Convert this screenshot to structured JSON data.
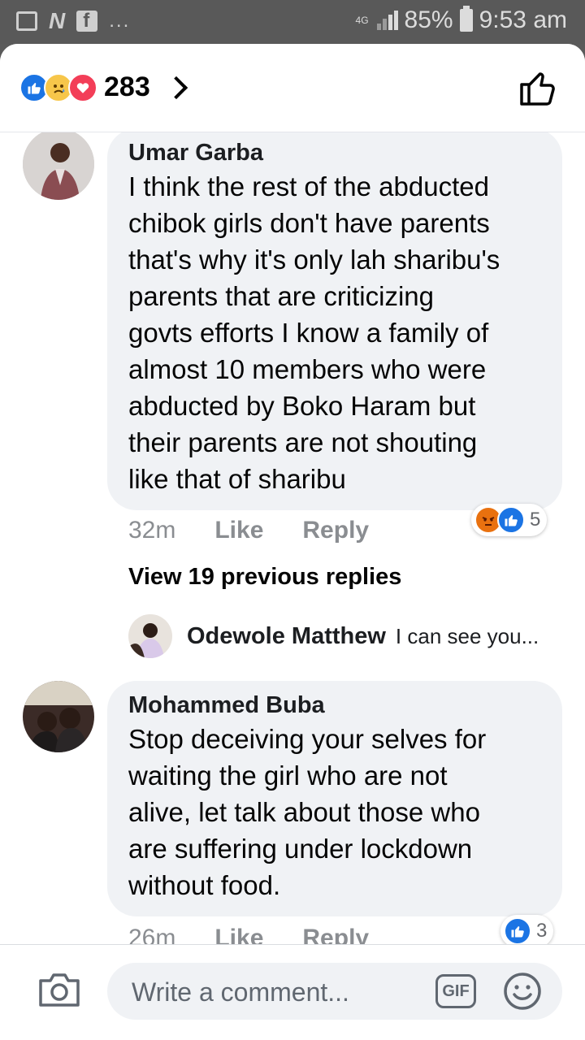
{
  "status_bar": {
    "network": "4G",
    "battery": "85%",
    "time": "9:53 am"
  },
  "header": {
    "reaction_count": "283",
    "reaction_icons": [
      "like-icon",
      "sad-icon",
      "love-icon"
    ]
  },
  "comments": [
    {
      "author": "Umar Garba",
      "text": "I think the rest of the abducted\nchibok girls don't have parents\nthat's why it's only lah sharibu's\nparents that are criticizing\ngovts efforts I know a family of\nalmost 10 members who were\nabducted by Boko Haram but\ntheir parents are not shouting\nlike that of sharibu",
      "time": "32m",
      "like_label": "Like",
      "reply_label": "Reply",
      "reaction_count": "5",
      "reaction_icons": [
        "angry-icon",
        "like-icon"
      ]
    },
    {
      "author": "Mohammed Buba",
      "text": "Stop deceiving your selves for\nwaiting the girl who are not\nalive, let talk about those who\nare suffering under lockdown\nwithout food.",
      "time": "26m",
      "like_label": "Like",
      "reply_label": "Reply",
      "reaction_count": "3",
      "reaction_icons": [
        "like-icon"
      ]
    }
  ],
  "replies_section": {
    "view_previous": "View 19 previous replies",
    "latest_reply_author": "Odewole Matthew",
    "latest_reply_preview": "I can see you..."
  },
  "composer": {
    "placeholder": "Write a comment...",
    "gif_label": "GIF"
  },
  "colors": {
    "like_blue": "#1b74e4",
    "love_red": "#f33e58",
    "sad_yellow": "#f7c64a",
    "angry_orange": "#e9710f",
    "bubble_gray": "#f0f2f5"
  }
}
